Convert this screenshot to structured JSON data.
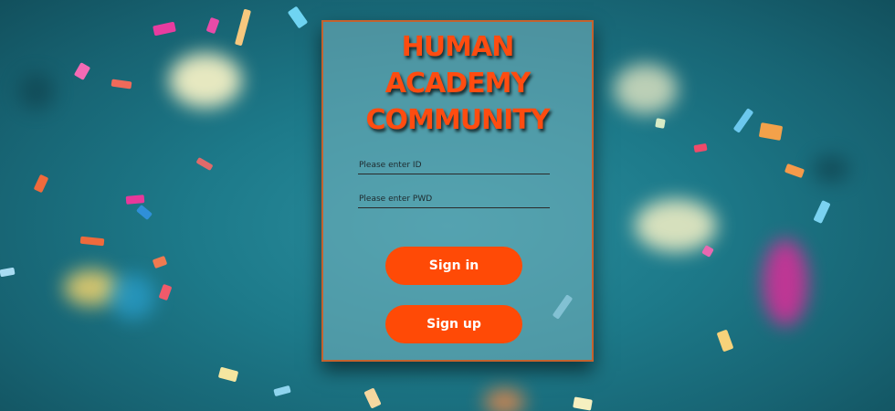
{
  "login_card": {
    "title_lines": [
      "HUMAN",
      "ACADEMY",
      "COMMUNITY"
    ],
    "id_field": {
      "value": "",
      "placeholder": "Please enter ID"
    },
    "pwd_field": {
      "value": "",
      "placeholder": "Please enter PWD"
    },
    "sign_in_label": "Sign in",
    "sign_up_label": "Sign up"
  },
  "colors": {
    "accent": "#ff4a06",
    "title": "#ff4c10",
    "card_border": "#c4622e",
    "background": "#1d7a8a"
  },
  "background_image": "blurred-teal-confetti"
}
